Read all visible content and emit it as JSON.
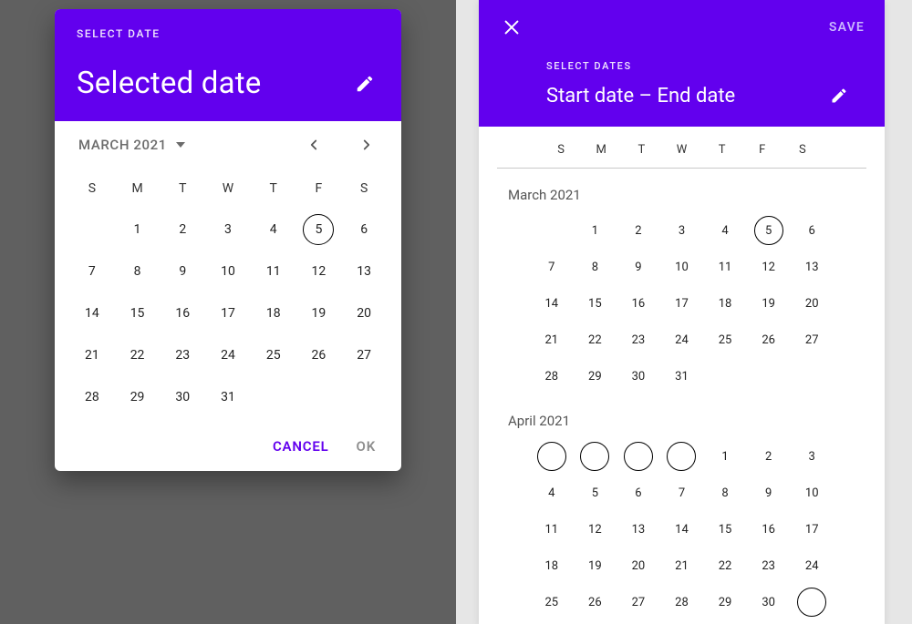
{
  "colors": {
    "primary": "#6200ee"
  },
  "left": {
    "overline": "SELECT DATE",
    "title": "Selected date",
    "month_label": "MARCH 2021",
    "dow": [
      "S",
      "M",
      "T",
      "W",
      "T",
      "F",
      "S"
    ],
    "month": {
      "leading_blanks": 1,
      "days": 31,
      "today": 5
    },
    "actions": {
      "cancel": "CANCEL",
      "ok": "OK"
    }
  },
  "right": {
    "save": "SAVE",
    "overline": "SELECT DATES",
    "title": "Start date – End date",
    "dow": [
      "S",
      "M",
      "T",
      "W",
      "T",
      "F",
      "S"
    ],
    "months": [
      {
        "label": "March 2021",
        "leading_blanks": 1,
        "days": 31,
        "today": 5
      },
      {
        "label": "April 2021",
        "leading_blanks": 4,
        "days": 30,
        "today": null
      }
    ]
  }
}
